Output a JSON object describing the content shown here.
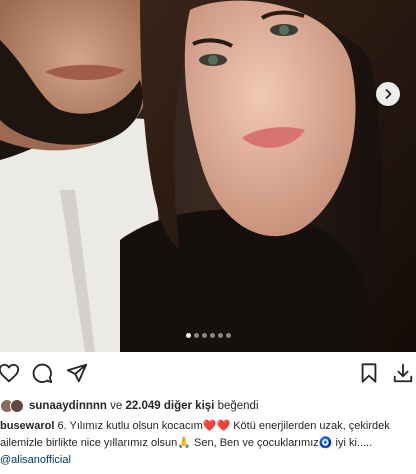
{
  "post": {
    "photo": {
      "description_icon": "couple-photo",
      "slide_count": 6,
      "active_slide": 1
    },
    "actions": {
      "like_icon": "heart-icon",
      "comment_icon": "comment-icon",
      "share_icon": "paper-plane-icon",
      "save_icon": "bookmark-icon",
      "download_icon": "download-icon"
    },
    "likes": {
      "first_user": "sunaaydinnnn",
      "connector": " ve ",
      "others": "22.049 diğer kişi",
      "suffix": " beğendi"
    },
    "caption": {
      "username": "busewarol",
      "line1": " 6. Yılımız kutlu olsun kocacım❤️❤️ Kötü enerjilerden uzak, çekirdek",
      "line2": "ailemizle birlikte nice yıllarımız olsun🙏 Sen, Ben ve çocuklarımız🧿 iyi ki.....",
      "mention": "@alisanofficial"
    }
  }
}
